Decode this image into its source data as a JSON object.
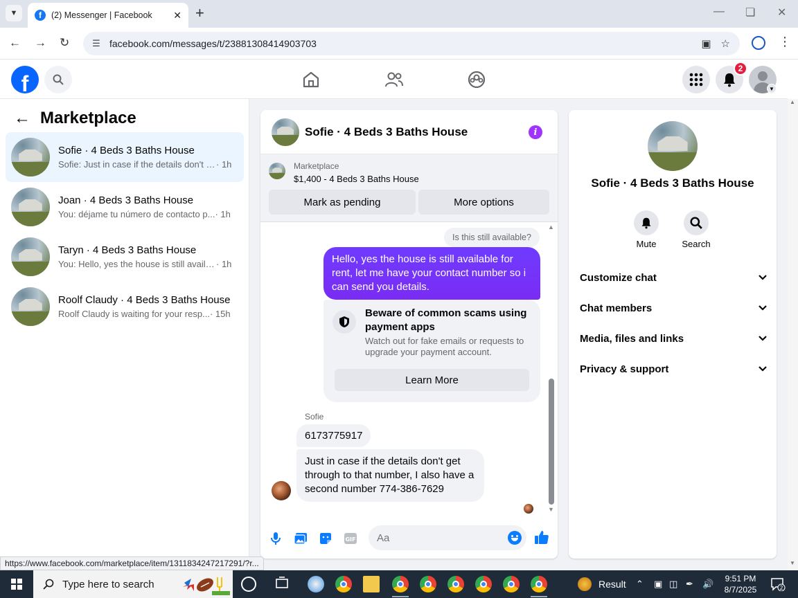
{
  "browser": {
    "tab_title": "(2) Messenger | Facebook",
    "url": "facebook.com/messages/t/23881308414903703"
  },
  "fb": {
    "notification_count": "2"
  },
  "left": {
    "header": "Marketplace",
    "conversations": [
      {
        "name": "Sofie · 4 Beds 3 Baths House",
        "preview": "Sofie: Just in case if the details don't g...",
        "time": "· 1h"
      },
      {
        "name": "Joan · 4 Beds 3 Baths House",
        "preview": "You: déjame tu número de contacto p...",
        "time": "· 1h"
      },
      {
        "name": "Taryn · 4 Beds 3 Baths House",
        "preview": "You: Hello, yes the house is still availa...",
        "time": "· 1h"
      },
      {
        "name": "Roolf Claudy · 4 Beds 3 Baths House",
        "preview": "Roolf Claudy is waiting for your resp...",
        "time": "· 15h"
      }
    ]
  },
  "chat": {
    "title": "Sofie · 4 Beds 3 Baths House",
    "marketplace_label": "Marketplace",
    "listing": "$1,400 - 4 Beds 3 Baths House",
    "mark_pending": "Mark as pending",
    "more_options": "More options",
    "question": "Is this still available?",
    "outgoing": "Hello, yes the house is still available for rent, let me have your contact number so i can send you details.",
    "scam_title": "Beware of common scams using payment apps",
    "scam_desc": "Watch out for fake emails or requests to upgrade your payment account.",
    "learn_more": "Learn More",
    "sender": "Sofie",
    "incoming1": "6173775917",
    "incoming2": "Just in case if the details don't get through to that number, I also have a second number 774-386-7629",
    "composer_placeholder": "Aa"
  },
  "right": {
    "title": "Sofie · 4 Beds 3 Baths House",
    "mute": "Mute",
    "search": "Search",
    "sections": [
      "Customize chat",
      "Chat members",
      "Media, files and links",
      "Privacy & support"
    ]
  },
  "status_url": "https://www.facebook.com/marketplace/item/1311834247217291/?r...",
  "taskbar": {
    "search_placeholder": "Type here to search",
    "result_label": "Result",
    "time": "9:51 PM",
    "date": "8/7/2025",
    "notif_count": "2"
  },
  "colors": {
    "fb_blue": "#0866ff",
    "messenger_purple": "#7b2ff7",
    "badge_red": "#e41e3f"
  }
}
